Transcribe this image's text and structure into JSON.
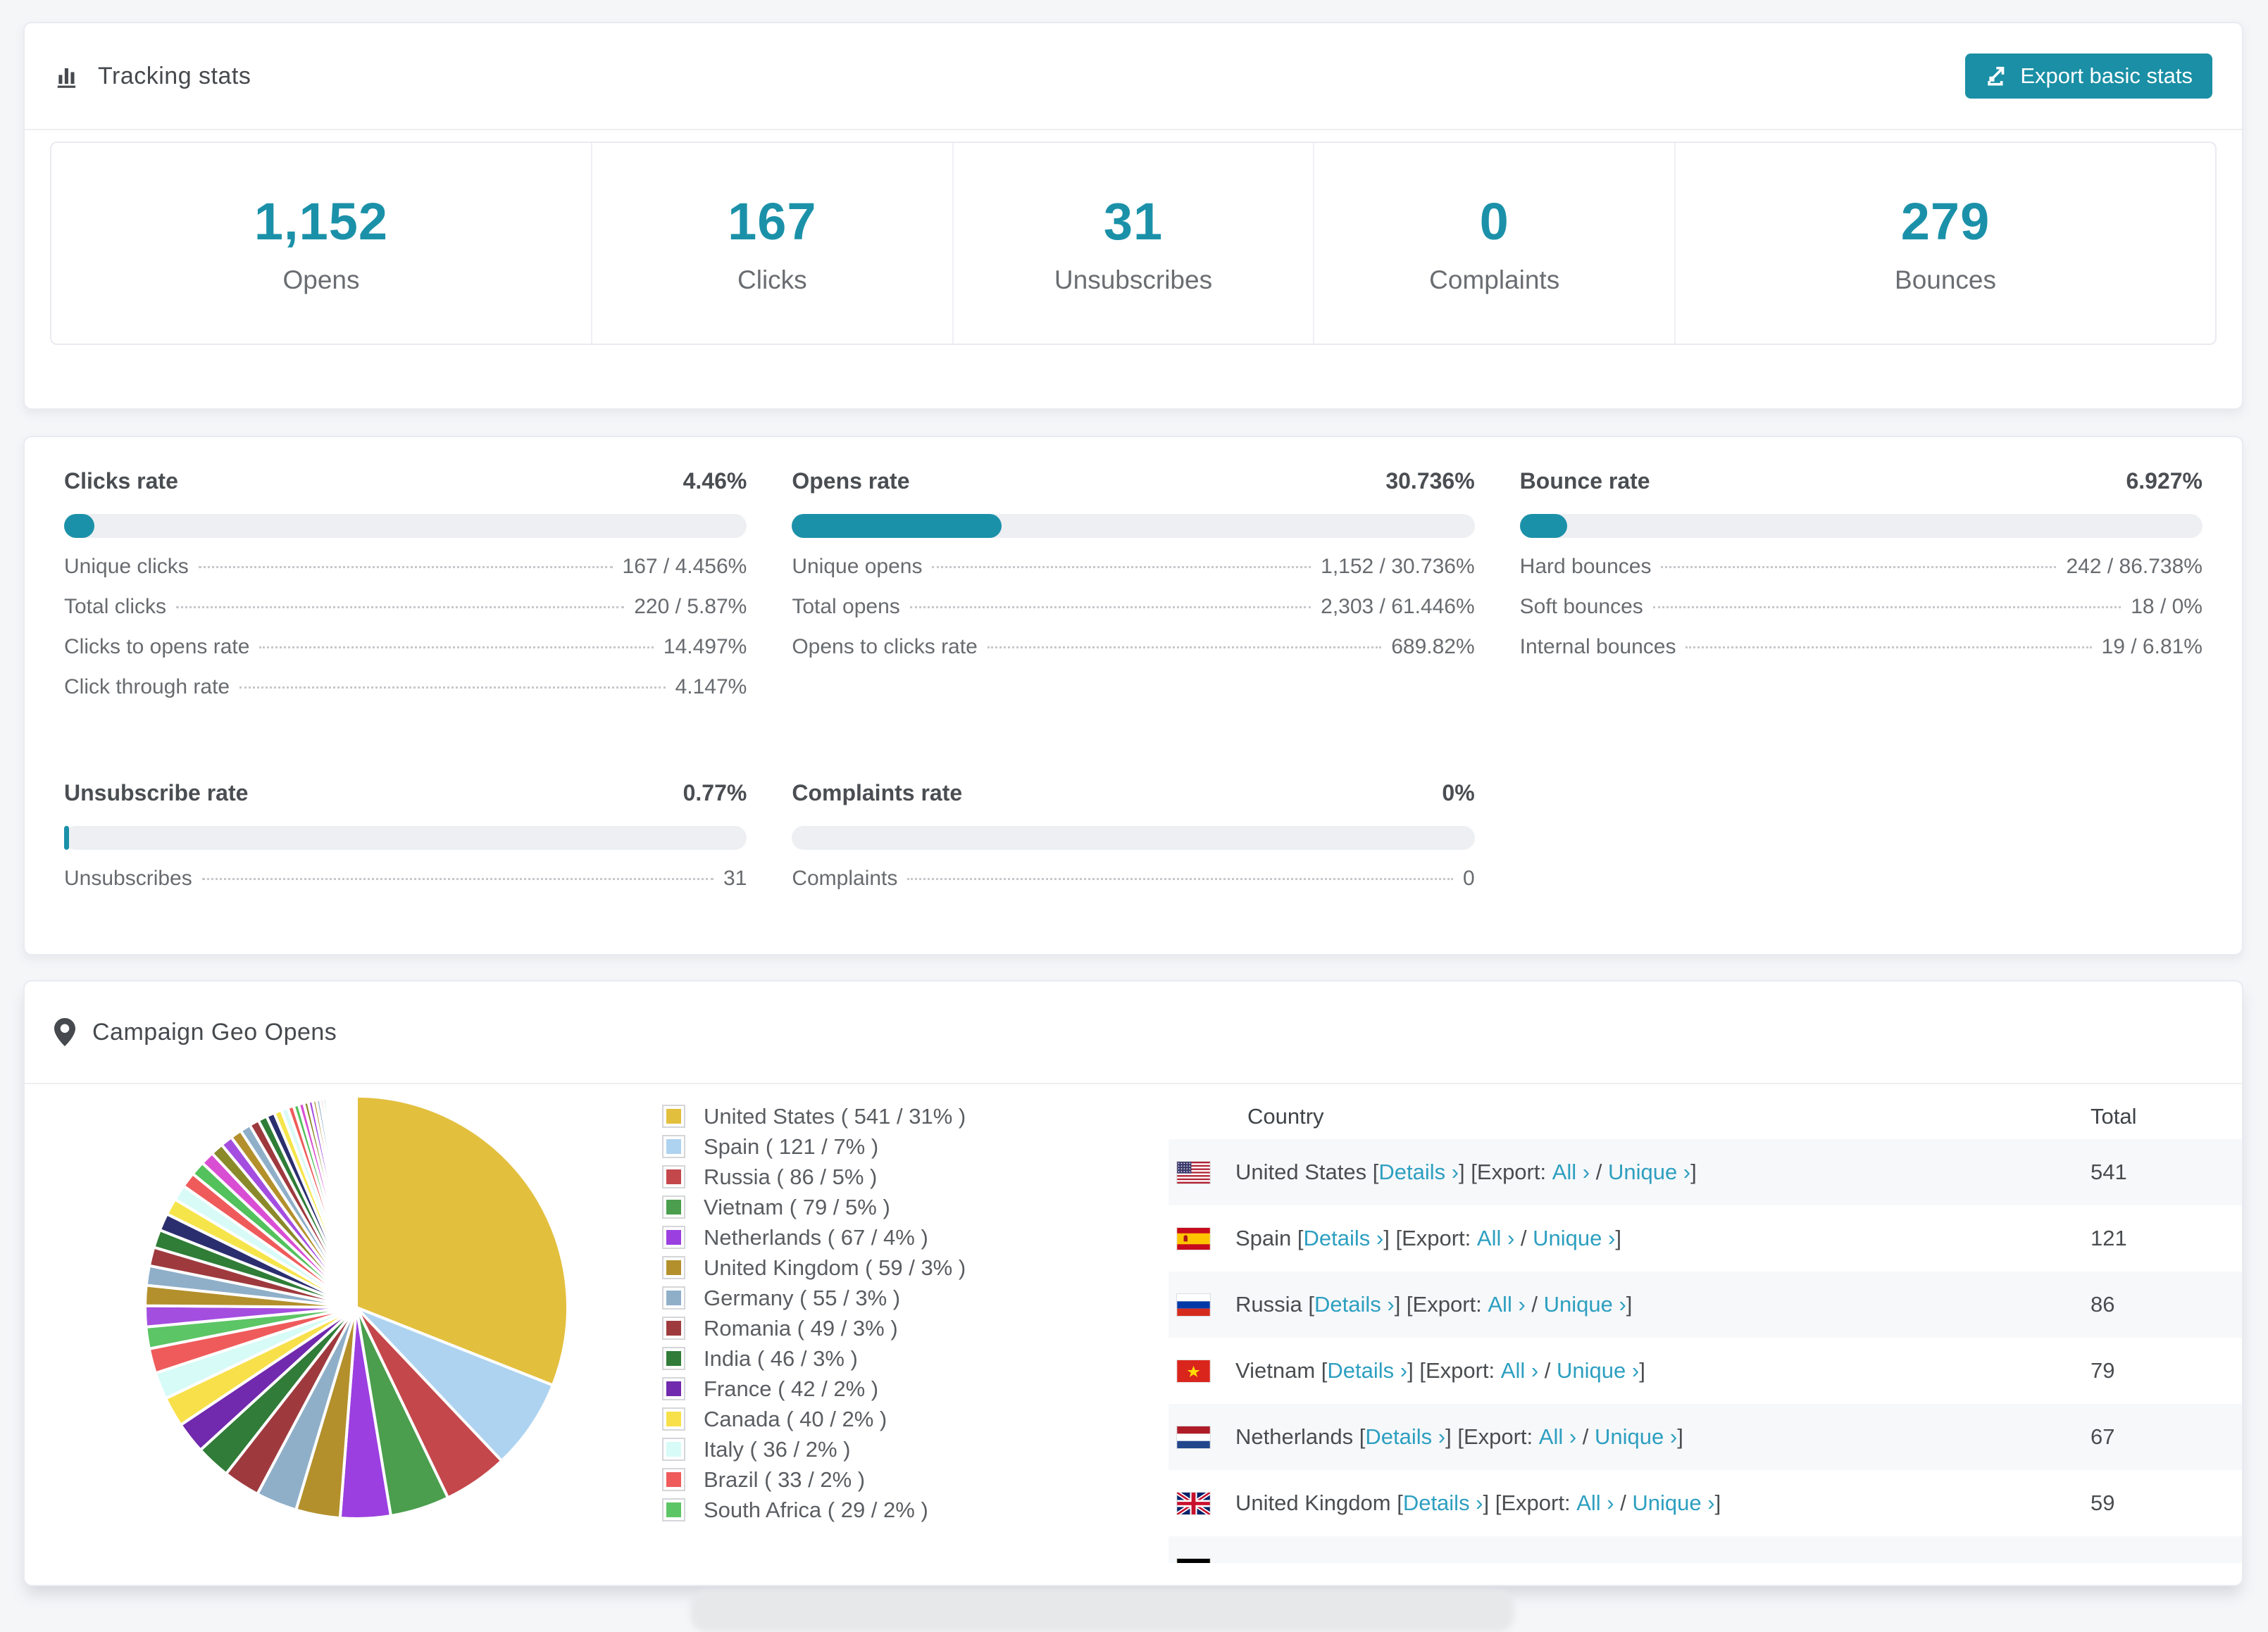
{
  "tracking": {
    "title": "Tracking stats",
    "export_button": "Export basic stats",
    "stats": [
      {
        "value": "1,152",
        "label": "Opens"
      },
      {
        "value": "167",
        "label": "Clicks"
      },
      {
        "value": "31",
        "label": "Unsubscribes"
      },
      {
        "value": "0",
        "label": "Complaints"
      },
      {
        "value": "279",
        "label": "Bounces"
      }
    ]
  },
  "rates": {
    "clicks": {
      "title": "Clicks rate",
      "value": "4.46%",
      "percent": 4.46,
      "rows": [
        {
          "label": "Unique clicks",
          "value": "167 / 4.456%"
        },
        {
          "label": "Total clicks",
          "value": "220 / 5.87%"
        },
        {
          "label": "Clicks to opens rate",
          "value": "14.497%"
        },
        {
          "label": "Click through rate",
          "value": "4.147%"
        }
      ]
    },
    "opens": {
      "title": "Opens rate",
      "value": "30.736%",
      "percent": 30.736,
      "rows": [
        {
          "label": "Unique opens",
          "value": "1,152 / 30.736%"
        },
        {
          "label": "Total opens",
          "value": "2,303 / 61.446%"
        },
        {
          "label": "Opens to clicks rate",
          "value": "689.82%"
        }
      ]
    },
    "bounce": {
      "title": "Bounce rate",
      "value": "6.927%",
      "percent": 6.927,
      "rows": [
        {
          "label": "Hard bounces",
          "value": "242 / 86.738%"
        },
        {
          "label": "Soft bounces",
          "value": "18 / 0%"
        },
        {
          "label": "Internal bounces",
          "value": "19 / 6.81%"
        }
      ]
    },
    "unsubscribe": {
      "title": "Unsubscribe rate",
      "value": "0.77%",
      "percent": 0.77,
      "rows": [
        {
          "label": "Unsubscribes",
          "value": "31"
        }
      ]
    },
    "complaints": {
      "title": "Complaints rate",
      "value": "0%",
      "percent": 0,
      "rows": [
        {
          "label": "Complaints",
          "value": "0"
        }
      ]
    }
  },
  "geo": {
    "title": "Campaign Geo Opens",
    "table": {
      "header": {
        "country": "Country",
        "total": "Total"
      },
      "link_labels": {
        "details": "Details ›",
        "export": "Export:",
        "all": "All ›",
        "unique": "Unique ›",
        "bracket_open": "[",
        "bracket_close": "]",
        "separator": " / "
      },
      "rows": [
        {
          "country": "United States",
          "flag": "us",
          "total": "541"
        },
        {
          "country": "Spain",
          "flag": "spain",
          "total": "121"
        },
        {
          "country": "Russia",
          "flag": "russia",
          "total": "86"
        },
        {
          "country": "Vietnam",
          "flag": "vietnam",
          "total": "79"
        },
        {
          "country": "Netherlands",
          "flag": "netherlands",
          "total": "67"
        },
        {
          "country": "United Kingdom",
          "flag": "uk",
          "total": "59"
        },
        {
          "country": "",
          "flag": "germany",
          "total": ""
        }
      ]
    }
  },
  "chart_data": {
    "type": "pie",
    "title": "Campaign Geo Opens",
    "legend_position": "left-of-table",
    "labels": [
      "United States",
      "Spain",
      "Russia",
      "Vietnam",
      "Netherlands",
      "United Kingdom",
      "Germany",
      "Romania",
      "India",
      "France",
      "Canada",
      "Italy",
      "Brazil",
      "South Africa"
    ],
    "values": [
      541,
      121,
      86,
      79,
      67,
      59,
      55,
      49,
      46,
      42,
      40,
      36,
      33,
      29
    ],
    "legend_texts": [
      "United States ( 541 / 31% )",
      "Spain ( 121 / 7% )",
      "Russia ( 86 / 5% )",
      "Vietnam ( 79 / 5% )",
      "Netherlands ( 67 / 4% )",
      "United Kingdom ( 59 / 3% )",
      "Germany ( 55 / 3% )",
      "Romania ( 49 / 3% )",
      "India ( 46 / 3% )",
      "France ( 42 / 2% )",
      "Canada ( 40 / 2% )",
      "Italy ( 36 / 2% )",
      "Brazil ( 33 / 2% )",
      "South Africa ( 29 / 2% )"
    ],
    "colors": [
      "#e3bf3e",
      "#aed3f0",
      "#c4474b",
      "#4a9e4d",
      "#9b3fe0",
      "#b3902c",
      "#8fafc9",
      "#9e3a3e",
      "#307c38",
      "#7129ad",
      "#f7e04a",
      "#d7fbf7",
      "#ef5b5b",
      "#5cc565"
    ],
    "unlabeled_tail_values": [
      28,
      27,
      26,
      25,
      24,
      23,
      22,
      21,
      20,
      19,
      18,
      17,
      16,
      15,
      14,
      13,
      12,
      11,
      10,
      9,
      8,
      7,
      7,
      6,
      6,
      5,
      5,
      4,
      4,
      3,
      3,
      3,
      2,
      2,
      2,
      2,
      2,
      2,
      1,
      1,
      1,
      1,
      1,
      1,
      1,
      1,
      1,
      1,
      1,
      1,
      1,
      1,
      1,
      1,
      1,
      1,
      1
    ],
    "tail_palette": [
      "#a44ee0",
      "#b3902c",
      "#8fafc9",
      "#9e3a3e",
      "#2f7d36",
      "#2b2e6e",
      "#f6e54a",
      "#d9fbf8",
      "#ef5b5b",
      "#53c15c",
      "#d94fd4",
      "#8a8a2a"
    ],
    "start_angle_deg": -90,
    "direction": "clockwise"
  },
  "colors": {
    "accent_teal": "#1b91a9",
    "link_teal": "#2d9fc0"
  }
}
